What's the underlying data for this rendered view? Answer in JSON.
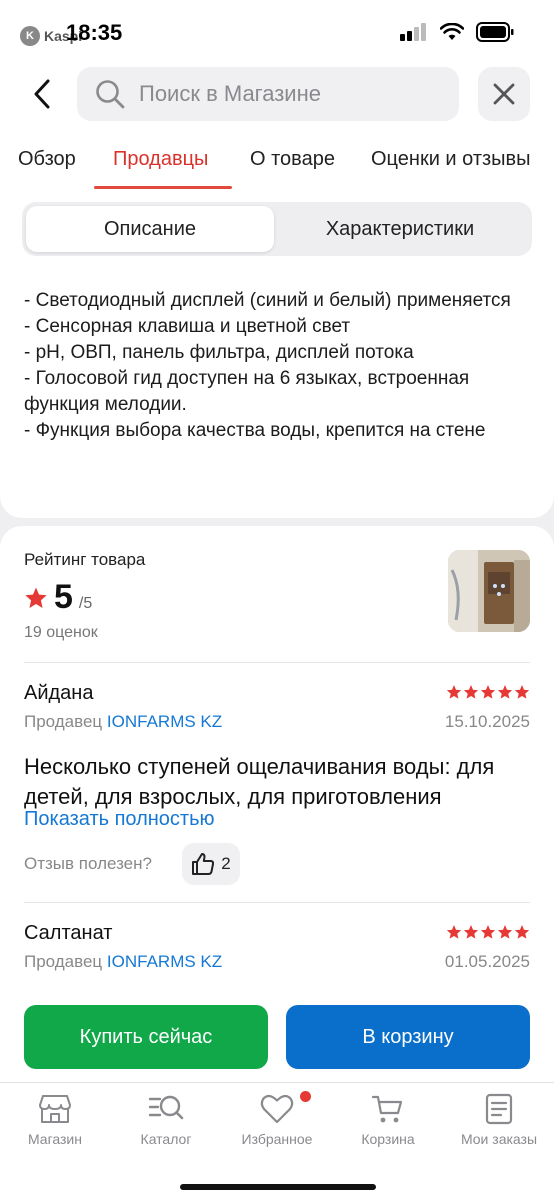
{
  "status_bar": {
    "time": "18:35",
    "app_back_label": "Kaspi"
  },
  "header": {
    "search_placeholder": "Поиск в Магазине"
  },
  "tabs": [
    {
      "label": "Обзор",
      "active": false
    },
    {
      "label": "Продавцы",
      "active": true
    },
    {
      "label": "О товаре",
      "active": false
    },
    {
      "label": "Оценки и отзывы",
      "active": false
    }
  ],
  "segment": {
    "description_label": "Описание",
    "specs_label": "Характеристики",
    "selected": "description"
  },
  "description_lines": [
    "- Светодиодный дисплей (синий и белый) применяется",
    "- Сенсорная клавиша и цветной свет",
    "- pH, ОВП, панель фильтра, дисплей потока",
    "- Голосовой гид доступен на 6 языках, встроенная функция мелодии.",
    "- Функция выбора качества воды, крепится на стене"
  ],
  "rating": {
    "title": "Рейтинг товара",
    "value": "5",
    "max": "/5",
    "count": "19 оценок"
  },
  "reviews": [
    {
      "author": "Айдана",
      "seller_prefix": "Продавец",
      "seller_name": "IONFARMS KZ",
      "date": "15.10.2025",
      "stars": 5,
      "text": "Несколько ступеней ощелачивания воды: для детей, для взрослых, для приготовления",
      "show_more": "Показать полностью",
      "useful_label": "Отзыв полезен?",
      "likes": "2"
    },
    {
      "author": "Салтанат",
      "seller_prefix": "Продавец",
      "seller_name": "IONFARMS KZ",
      "date": "01.05.2025",
      "stars": 5
    }
  ],
  "actions": {
    "buy_now": "Купить сейчас",
    "add_to_cart": "В корзину"
  },
  "bottom_nav": [
    {
      "label": "Магазин",
      "icon": "store-icon"
    },
    {
      "label": "Каталог",
      "icon": "catalog-search-icon"
    },
    {
      "label": "Избранное",
      "icon": "heart-icon",
      "badge": true
    },
    {
      "label": "Корзина",
      "icon": "cart-icon"
    },
    {
      "label": "Мои заказы",
      "icon": "orders-icon"
    }
  ],
  "colors": {
    "accent_red": "#d9322a",
    "link_blue": "#1578d4",
    "buy_green": "#11a84a",
    "cart_blue": "#0a6fcb",
    "star_red": "#e53935"
  }
}
